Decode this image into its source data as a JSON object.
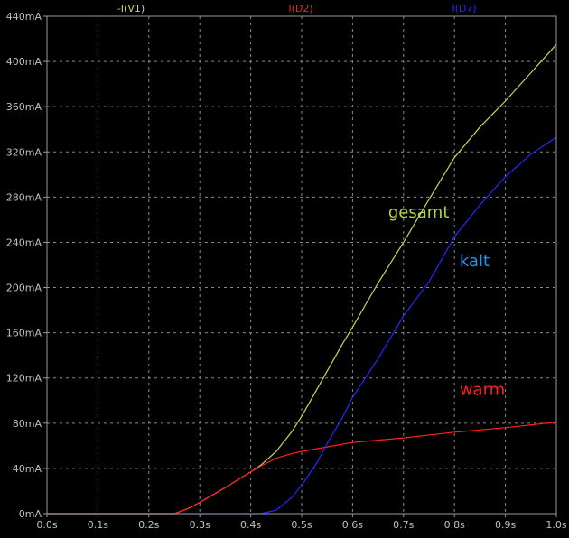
{
  "chart_data": {
    "type": "line",
    "title": "",
    "xlabel": "",
    "ylabel": "",
    "xlim": [
      0,
      1.0
    ],
    "ylim": [
      0,
      440
    ],
    "grid": true,
    "legend_position": "top",
    "x_ticks": [
      "0.0s",
      "0.1s",
      "0.2s",
      "0.3s",
      "0.4s",
      "0.5s",
      "0.6s",
      "0.7s",
      "0.8s",
      "0.9s",
      "1.0s"
    ],
    "y_ticks": [
      "0mA",
      "40mA",
      "80mA",
      "120mA",
      "160mA",
      "200mA",
      "240mA",
      "280mA",
      "320mA",
      "360mA",
      "400mA",
      "440mA"
    ],
    "series": [
      {
        "name": "-I(V1)",
        "color": "#c8d850",
        "x": [
          0,
          0.25,
          0.28,
          0.3,
          0.35,
          0.4,
          0.42,
          0.45,
          0.48,
          0.5,
          0.53,
          0.55,
          0.58,
          0.6,
          0.65,
          0.7,
          0.75,
          0.8,
          0.85,
          0.9,
          0.95,
          1.0
        ],
        "y": [
          0,
          0,
          5,
          10,
          23,
          37,
          43,
          55,
          72,
          86,
          110,
          126,
          150,
          165,
          204,
          240,
          278,
          315,
          342,
          365,
          390,
          415
        ]
      },
      {
        "name": "I(D2)",
        "color": "#ff2020",
        "x": [
          0,
          0.25,
          0.28,
          0.3,
          0.35,
          0.4,
          0.42,
          0.45,
          0.48,
          0.5,
          0.55,
          0.6,
          0.7,
          0.8,
          0.9,
          1.0
        ],
        "y": [
          0,
          0,
          5,
          10,
          23,
          37,
          42,
          49,
          53,
          55,
          59,
          63,
          67,
          72,
          76,
          81
        ]
      },
      {
        "name": "I(D7)",
        "color": "#2828ff",
        "x": [
          0,
          0.42,
          0.45,
          0.48,
          0.5,
          0.53,
          0.55,
          0.58,
          0.6,
          0.65,
          0.7,
          0.75,
          0.8,
          0.85,
          0.9,
          0.95,
          1.0
        ],
        "y": [
          0,
          0,
          3,
          14,
          25,
          45,
          62,
          85,
          103,
          137,
          175,
          205,
          245,
          273,
          298,
          318,
          333
        ]
      }
    ],
    "annotations": [
      {
        "text": "gesamt",
        "color": "#b9d63a",
        "x": 0.67,
        "y": 262
      },
      {
        "text": "kalt",
        "color": "#2196e8",
        "x": 0.81,
        "y": 219
      },
      {
        "text": "warm",
        "color": "#ff2020",
        "x": 0.81,
        "y": 105
      }
    ]
  }
}
